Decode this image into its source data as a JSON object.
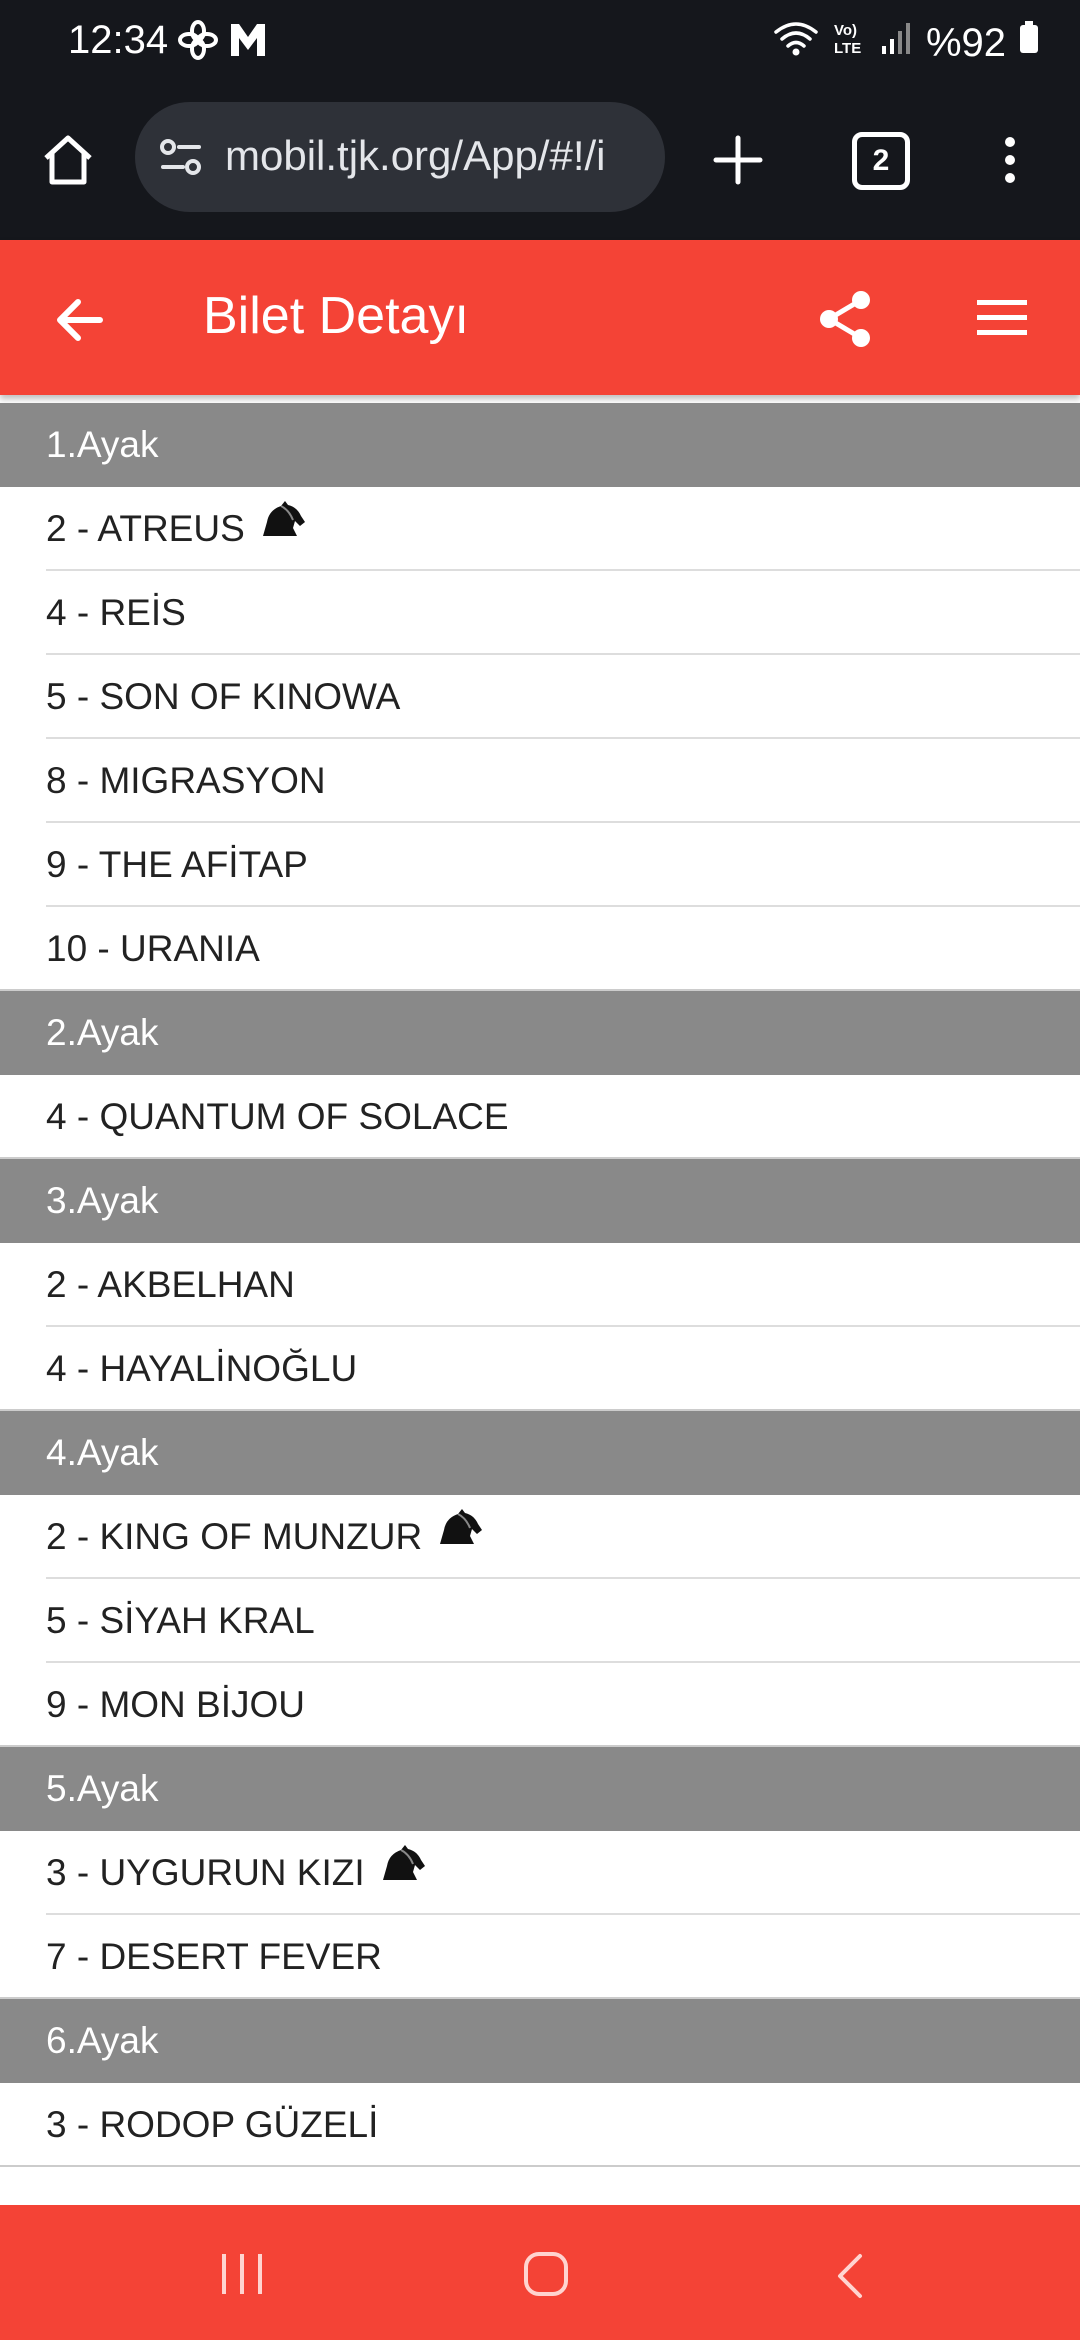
{
  "status_bar": {
    "time": "12:34",
    "battery": "%92",
    "icons": [
      "pinwheel-icon",
      "gmail-icon",
      "wifi-icon",
      "volte-icon",
      "signal-icon",
      "battery-icon"
    ]
  },
  "browser": {
    "url": "mobil.tjk.org/App/#!/i",
    "tab_count": "2",
    "icons": [
      "home-icon",
      "tune-icon",
      "plus-icon",
      "more-vert-icon"
    ]
  },
  "header": {
    "title": "Bilet Detayı",
    "background": "#f44336",
    "icons": [
      "arrow-back-icon",
      "share-icon",
      "hamburger-menu-icon"
    ]
  },
  "legs": [
    {
      "label": "1.Ayak",
      "horses": [
        {
          "text": "2 - ATREUS",
          "icon": true
        },
        {
          "text": "4 - REİS",
          "icon": false
        },
        {
          "text": "5 - SON OF KINOWA",
          "icon": false
        },
        {
          "text": "8 - MIGRASYON",
          "icon": false
        },
        {
          "text": "9 - THE AFİTAP",
          "icon": false
        },
        {
          "text": "10 - URANIA",
          "icon": false
        }
      ]
    },
    {
      "label": "2.Ayak",
      "horses": [
        {
          "text": "4 - QUANTUM OF SOLACE",
          "icon": false
        }
      ]
    },
    {
      "label": "3.Ayak",
      "horses": [
        {
          "text": "2 - AKBELHAN",
          "icon": false
        },
        {
          "text": "4 - HAYALİNOĞLU",
          "icon": false
        }
      ]
    },
    {
      "label": "4.Ayak",
      "horses": [
        {
          "text": "2 - KING OF MUNZUR",
          "icon": true
        },
        {
          "text": "5 - SİYAH KRAL",
          "icon": false
        },
        {
          "text": "9 - MON BİJOU",
          "icon": false
        }
      ]
    },
    {
      "label": "5.Ayak",
      "horses": [
        {
          "text": "3 - UYGURUN KIZI",
          "icon": true
        },
        {
          "text": "7 - DESERT FEVER",
          "icon": false
        }
      ]
    },
    {
      "label": "6.Ayak",
      "horses": [
        {
          "text": "3 - RODOP GÜZELİ",
          "icon": false
        }
      ]
    }
  ],
  "nav_bar": {
    "icons": [
      "recents-icon",
      "home-outline-icon",
      "nav-back-icon"
    ]
  }
}
